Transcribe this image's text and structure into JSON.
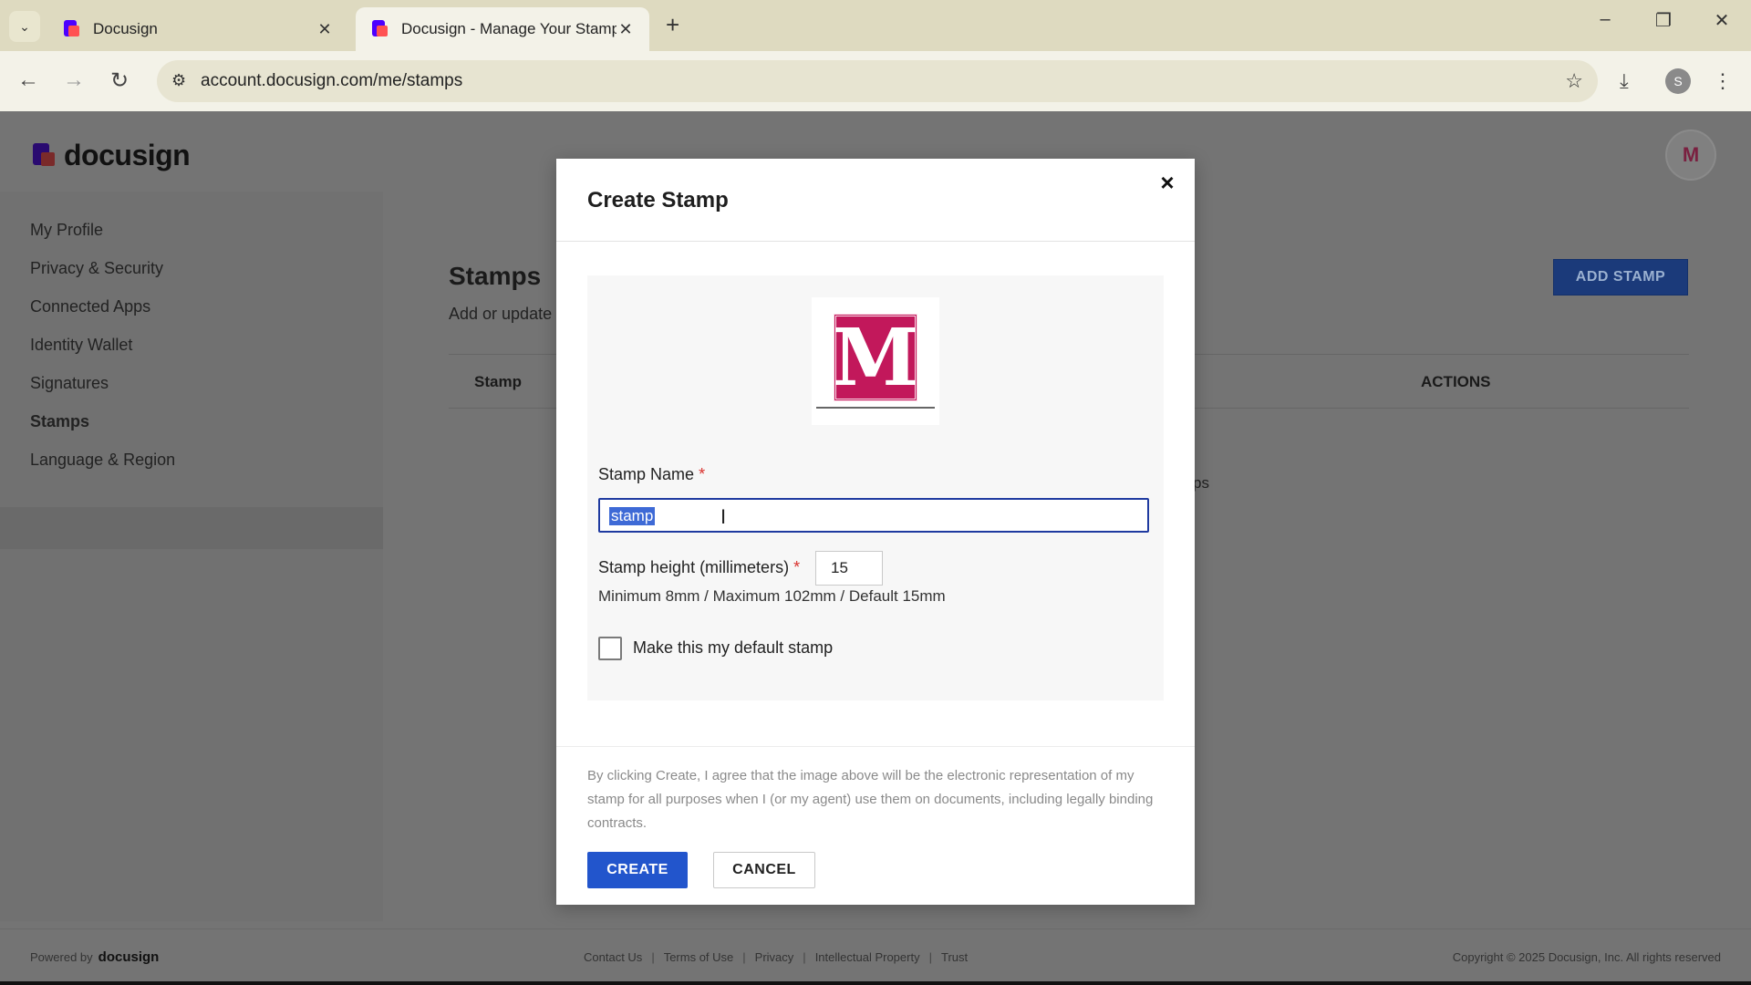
{
  "browser": {
    "tabs": [
      {
        "title": "Docusign",
        "active": false
      },
      {
        "title": "Docusign - Manage Your Stamp",
        "active": true
      }
    ],
    "url": "account.docusign.com/me/stamps",
    "profile_initial": "S"
  },
  "app": {
    "logo_text": "docusign",
    "avatar_initial": "M"
  },
  "sidebar": {
    "items": [
      {
        "label": "My Profile"
      },
      {
        "label": "Privacy & Security"
      },
      {
        "label": "Connected Apps"
      },
      {
        "label": "Identity Wallet"
      },
      {
        "label": "Signatures"
      },
      {
        "label": "Stamps",
        "active": true
      },
      {
        "label": "Language & Region"
      }
    ]
  },
  "main": {
    "title": "Stamps",
    "subtitle": "Add or update",
    "add_button": "ADD STAMP",
    "table": {
      "columns": [
        "Stamp",
        "ACTIONS"
      ]
    },
    "fragment": "ps"
  },
  "modal": {
    "title": "Create Stamp",
    "stamp_letter": "M",
    "name_label": "Stamp Name",
    "required_mark": "*",
    "name_value": "stamp",
    "height_label": "Stamp height (millimeters)",
    "height_value": "15",
    "height_hint": "Minimum 8mm / Maximum 102mm / Default 15mm",
    "default_label": "Make this my default stamp",
    "default_checked": false,
    "consent": "By clicking Create, I agree that the image above will be the electronic representation of my stamp for all purposes when I (or my agent) use them on documents, including legally binding contracts.",
    "create_button": "CREATE",
    "cancel_button": "CANCEL"
  },
  "footer": {
    "powered_by": "Powered by",
    "powered_logo": "docusign",
    "links": [
      "Contact Us",
      "Terms of Use",
      "Privacy",
      "Intellectual Property",
      "Trust"
    ],
    "copyright": "Copyright © 2025 Docusign, Inc. All rights reserved"
  },
  "colors": {
    "primary": "#2255cc",
    "required": "#d9312d",
    "stamp": "#c2185b"
  }
}
